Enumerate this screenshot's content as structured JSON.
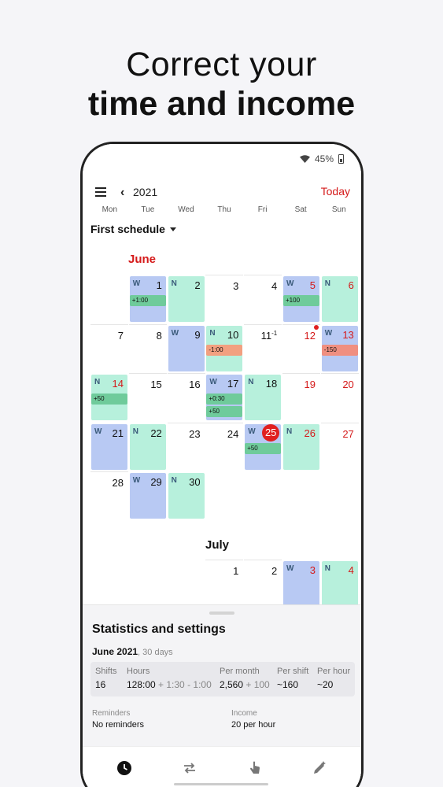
{
  "headline": {
    "line1": "Correct your",
    "line2": "time and income"
  },
  "statusbar": {
    "battery": "45%"
  },
  "appbar": {
    "year": "2021",
    "today_label": "Today"
  },
  "weekdays": [
    "Mon",
    "Tue",
    "Wed",
    "Thu",
    "Fri",
    "Sat",
    "Sun"
  ],
  "schedule_name": "First schedule",
  "months": {
    "june": "June",
    "july": "July"
  },
  "calendar": {
    "june": [
      [
        null,
        {
          "d": "1",
          "s": "W",
          "tags": [
            {
              "t": "+1:00",
              "c": "green"
            }
          ]
        },
        {
          "d": "2",
          "s": "N"
        },
        {
          "d": "3"
        },
        {
          "d": "4"
        },
        {
          "d": "5",
          "s": "W",
          "red": true,
          "tags": [
            {
              "t": "+100",
              "c": "green"
            }
          ]
        },
        {
          "d": "6",
          "s": "N",
          "red": true
        }
      ],
      [
        {
          "d": "7"
        },
        {
          "d": "8"
        },
        {
          "d": "9",
          "s": "W"
        },
        {
          "d": "10",
          "s": "N",
          "tags": [
            {
              "t": "-1:00",
              "c": "salmon"
            }
          ]
        },
        {
          "d": "11",
          "sup": "-1"
        },
        {
          "d": "12",
          "red": true,
          "dot": true
        },
        {
          "d": "13",
          "s": "W",
          "red": true,
          "tags": [
            {
              "t": "-150",
              "c": "red"
            }
          ]
        }
      ],
      [
        {
          "d": "14",
          "s": "N",
          "red": true,
          "tags": [
            {
              "t": "+50",
              "c": "green"
            }
          ]
        },
        {
          "d": "15"
        },
        {
          "d": "16"
        },
        {
          "d": "17",
          "s": "W",
          "tags": [
            {
              "t": "+0:30",
              "c": "green"
            },
            {
              "t": "+50",
              "c": "green"
            }
          ]
        },
        {
          "d": "18",
          "s": "N"
        },
        {
          "d": "19",
          "red": true
        },
        {
          "d": "20",
          "red": true
        }
      ],
      [
        {
          "d": "21",
          "s": "W"
        },
        {
          "d": "22",
          "s": "N"
        },
        {
          "d": "23"
        },
        {
          "d": "24"
        },
        {
          "d": "25",
          "s": "W",
          "today": true,
          "tags": [
            {
              "t": "+50",
              "c": "green"
            }
          ]
        },
        {
          "d": "26",
          "s": "N",
          "red": true
        },
        {
          "d": "27",
          "red": true
        }
      ],
      [
        {
          "d": "28"
        },
        {
          "d": "29",
          "s": "W"
        },
        {
          "d": "30",
          "s": "N"
        },
        null,
        null,
        null,
        null
      ]
    ],
    "july": [
      [
        null,
        null,
        null,
        {
          "d": "1"
        },
        {
          "d": "2"
        },
        {
          "d": "3",
          "s": "W",
          "red": true
        },
        {
          "d": "4",
          "s": "N",
          "red": true
        }
      ]
    ]
  },
  "stats": {
    "title": "Statistics and settings",
    "period": "June 2021",
    "period_days": ", 30 days",
    "shifts_label": "Shifts",
    "shifts_value": "16",
    "hours_label": "Hours",
    "hours_value": "128:00",
    "hours_extra": " + 1:30 - 1:00",
    "per_month_label": "Per month",
    "per_month_value": "2,560",
    "per_month_extra": " + 100",
    "per_shift_label": "Per shift",
    "per_shift_value": "~160",
    "per_hour_label": "Per hour",
    "per_hour_value": "~20",
    "reminders_label": "Reminders",
    "reminders_value": "No reminders",
    "income_label": "Income",
    "income_value": "20 per hour"
  },
  "nav": [
    "clock-icon",
    "repeat-icon",
    "touch-icon",
    "edit-icon"
  ]
}
